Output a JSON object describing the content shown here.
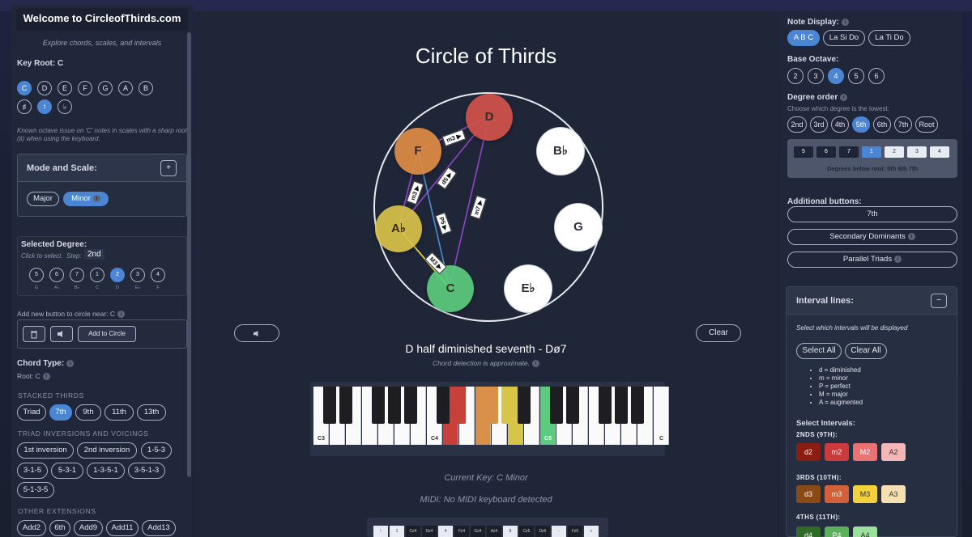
{
  "left": {
    "welcome": "Welcome to CircleofThirds.com",
    "tagline": "Explore chords, scales, and intervals",
    "key_root_label": "Key Root: C",
    "roots": [
      "C",
      "D",
      "E",
      "F",
      "G",
      "A",
      "B"
    ],
    "accidentals": [
      "♯",
      "♮",
      "♭"
    ],
    "octave_note": "Known octave issue on 'C' notes in scales with a sharp root (♯) when using the keyboard.",
    "mode_title": "Mode and Scale:",
    "mode_toggle": "+",
    "modes": [
      "Major",
      "Minor"
    ],
    "selected_degree_label": "Selected Degree:",
    "click_to_select": "Click to select.",
    "step_label": "Step:",
    "step_value": "2nd",
    "degrees": [
      "5",
      "6",
      "7",
      "1",
      "2",
      "3",
      "4"
    ],
    "degree_notes": [
      "G",
      "A♭",
      "B♭",
      "C",
      "D",
      "E♭",
      "F"
    ],
    "add_near_label": "Add new button to circle near: C",
    "add_to_circle": "Add to Circle",
    "chord_type_label": "Chord Type:",
    "chord_root": "Root: C",
    "stacked_thirds_label": "STACKED THIRDS",
    "stacked": [
      "Triad",
      "7th",
      "9th",
      "11th",
      "13th"
    ],
    "inversions_label": "TRIAD INVERSIONS AND VOICINGS",
    "inversions": [
      "1st inversion",
      "2nd inversion",
      "1-5-3",
      "3-1-5",
      "5-3-1",
      "1-3-5-1",
      "3-5-1-3",
      "5-1-3-5"
    ],
    "other_label": "OTHER EXTENSIONS",
    "other": [
      "Add2",
      "6th",
      "Add9",
      "Add11",
      "Add13"
    ]
  },
  "center": {
    "title": "Circle of Thirds",
    "nodes": [
      {
        "name": "D",
        "color": "#d2524a"
      },
      {
        "name": "F",
        "color": "#de8c46"
      },
      {
        "name": "B♭",
        "color": "#ffffff"
      },
      {
        "name": "A♭",
        "color": "#d8c24a"
      },
      {
        "name": "G",
        "color": "#ffffff"
      },
      {
        "name": "C",
        "color": "#5ccb7e"
      },
      {
        "name": "E♭",
        "color": "#ffffff"
      }
    ],
    "intervals": [
      "m3 ▶",
      "m3 ▶",
      "d5 ▶",
      "P5 ▶",
      "m7 ▶",
      "M3 ▶"
    ],
    "clear": "Clear",
    "chord_name": "D half diminished seventh - Dø7",
    "chord_note": "Chord detection is approximate.",
    "piano_labels": [
      "C3",
      "C4",
      "C5",
      "C"
    ],
    "current_key": "Current Key: C Minor",
    "midi": "MIDI: No MIDI keyboard detected",
    "keyboard_keys": [
      "\\",
      "1",
      "C♯4",
      "D♯4",
      "4",
      "F♯4",
      "G♯4",
      "A♯4",
      "8",
      "C♯5",
      "D♯5",
      "-",
      "F♯5",
      "+"
    ]
  },
  "right": {
    "note_display_label": "Note Display:",
    "note_display": [
      "A B C",
      "La Si Do",
      "La Ti Do"
    ],
    "base_octave_label": "Base Octave:",
    "octaves": [
      "2",
      "3",
      "4",
      "5",
      "6"
    ],
    "degree_order_label": "Degree order",
    "degree_order_note": "Choose which degree is the lowest:",
    "degree_order": [
      "2nd",
      "3rd",
      "4th",
      "5th",
      "6th",
      "7th",
      "Root"
    ],
    "degree_squares": [
      "5",
      "6",
      "7",
      "1",
      "2",
      "3",
      "4"
    ],
    "degrees_below": "Degrees below root: 5th 6th 7th",
    "additional_label": "Additional buttons:",
    "additional": [
      "7th",
      "Secondary Dominants",
      "Parallel Triads"
    ],
    "interval_lines_title": "Interval lines:",
    "interval_toggle": "−",
    "select_which": "Select which intervals will be displayed",
    "select_all": "Select All",
    "clear_all": "Clear All",
    "legend": [
      "d = diminished",
      "m = minor",
      "P = perfect",
      "M = major",
      "A = augmented"
    ],
    "select_intervals": "Select Intervals:",
    "seconds_label": "2NDS (9TH):",
    "seconds": [
      {
        "t": "d2",
        "c": "#8a1c12"
      },
      {
        "t": "m2",
        "c": "#cc3b3b"
      },
      {
        "t": "M2",
        "c": "#e97373"
      },
      {
        "t": "A2",
        "c": "#f4b7b7"
      }
    ],
    "thirds_label": "3RDS (10TH):",
    "thirds": [
      {
        "t": "d3",
        "c": "#8a4a16"
      },
      {
        "t": "m3",
        "c": "#d2603a"
      },
      {
        "t": "M3",
        "c": "#f2d13a"
      },
      {
        "t": "A3",
        "c": "#f6dfb0"
      }
    ],
    "fourths_label": "4THS (11TH):",
    "fourths": [
      {
        "t": "d4",
        "c": "#2f6b26"
      },
      {
        "t": "P4",
        "c": "#5cb05c"
      },
      {
        "t": "A4",
        "c": "#9be09b"
      }
    ]
  }
}
